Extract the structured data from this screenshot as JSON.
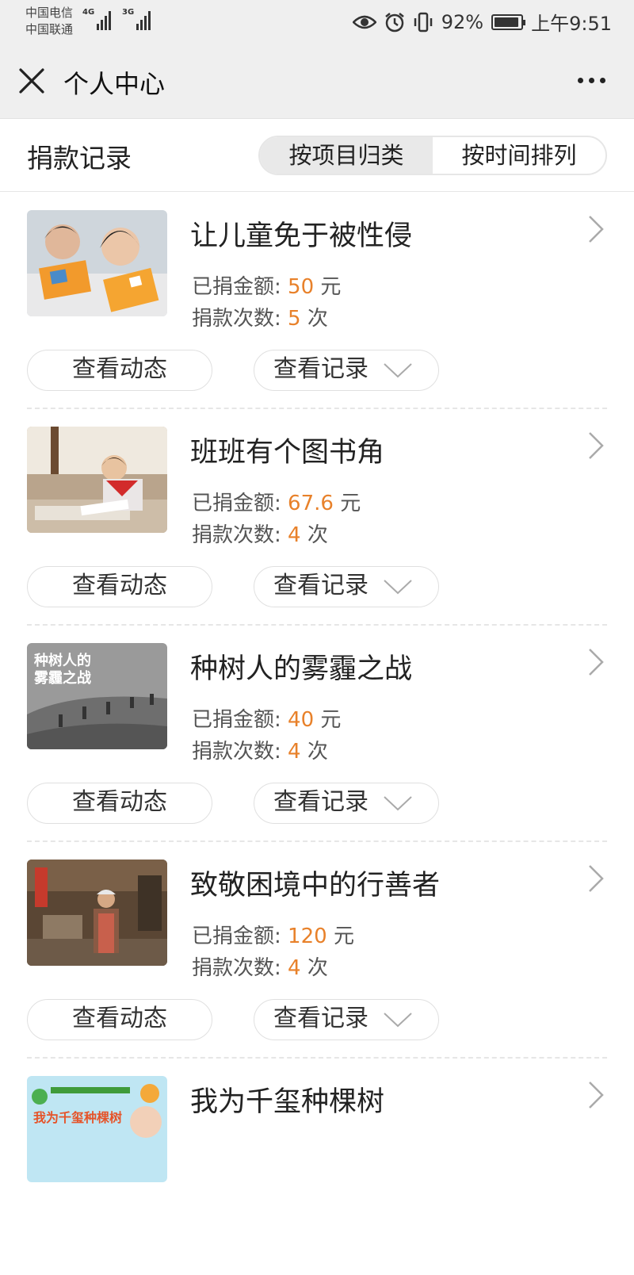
{
  "status_bar": {
    "carrier_1": "中国电信",
    "carrier_2": "中国联通",
    "net_1": "4G",
    "net_2": "3G",
    "battery": "92%",
    "time": "上午9:51"
  },
  "titlebar": {
    "title": "个人中心"
  },
  "section": {
    "title": "捐款记录",
    "tab_project": "按项目归类",
    "tab_time": "按时间排列",
    "active_tab": "按项目归类"
  },
  "labels": {
    "amount_label": "已捐金额:",
    "count_label": "捐款次数:",
    "yuan": "元",
    "times": "次",
    "view_updates": "查看动态",
    "view_records": "查看记录"
  },
  "projects": [
    {
      "title": "让儿童免于被性侵",
      "amount": "50",
      "count": "5"
    },
    {
      "title": "班班有个图书角",
      "amount": "67.6",
      "count": "4"
    },
    {
      "title": "种树人的雾霾之战",
      "amount": "40",
      "count": "4",
      "thumb_text_1": "种树人的",
      "thumb_text_2": "雾霾之战"
    },
    {
      "title": "致敬困境中的行善者",
      "amount": "120",
      "count": "4"
    },
    {
      "title": "我为千玺种棵树",
      "thumb_text": "我为千玺种棵树"
    }
  ],
  "colors": {
    "accent": "#e8812a",
    "header_bg": "#efefef"
  }
}
